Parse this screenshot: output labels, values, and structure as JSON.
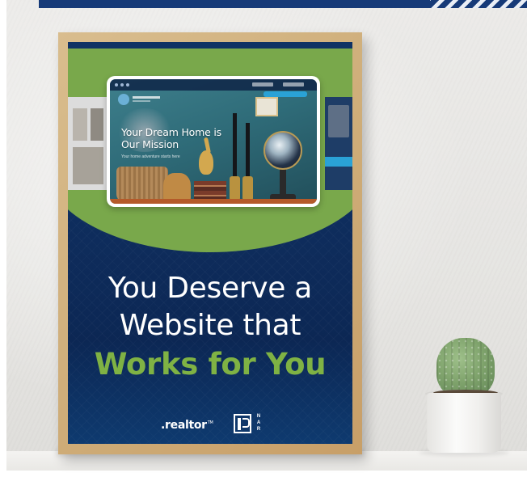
{
  "poster": {
    "mockup": {
      "headline": "Your Dream Home is Our Mission",
      "subtext": "Your home adventure starts here"
    },
    "headline": {
      "line1": "You Deserve a",
      "line2": "Website that",
      "accent": "Works for You"
    },
    "logos": {
      "realtor": ".realtor",
      "realtor_tm": "TM",
      "nar_letters": [
        "N",
        "A",
        "R"
      ]
    }
  },
  "colors": {
    "navy": "#0c2a57",
    "green": "#79a84b",
    "accent_text": "#7fb244",
    "frame_wood": "#cfae7a",
    "top_band": "#163a78"
  }
}
